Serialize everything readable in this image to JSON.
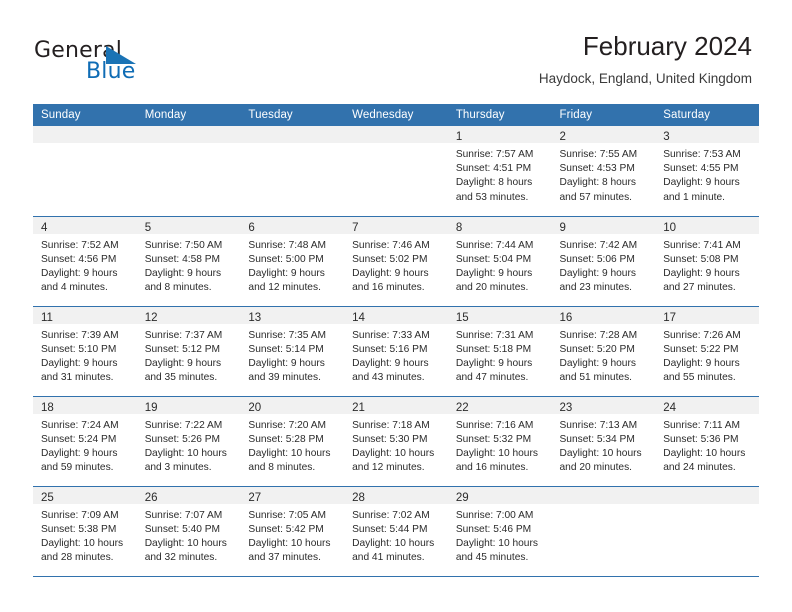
{
  "brand": {
    "name_part1": "General",
    "name_part2": "Blue",
    "flag_icon": "triangle-flag-icon"
  },
  "header": {
    "title": "February 2024",
    "location": "Haydock, England, United Kingdom"
  },
  "theme": {
    "header_blue": "#3272ad",
    "band_gray": "#f1f1f1",
    "brand_blue": "#0f6cb5",
    "text": "#2b2b2b"
  },
  "calendar": {
    "weekday_headers": [
      "Sunday",
      "Monday",
      "Tuesday",
      "Wednesday",
      "Thursday",
      "Friday",
      "Saturday"
    ],
    "weeks": [
      [
        {
          "day": "",
          "lines": []
        },
        {
          "day": "",
          "lines": []
        },
        {
          "day": "",
          "lines": []
        },
        {
          "day": "",
          "lines": []
        },
        {
          "day": "1",
          "lines": [
            "Sunrise: 7:57 AM",
            "Sunset: 4:51 PM",
            "Daylight: 8 hours",
            "and 53 minutes."
          ]
        },
        {
          "day": "2",
          "lines": [
            "Sunrise: 7:55 AM",
            "Sunset: 4:53 PM",
            "Daylight: 8 hours",
            "and 57 minutes."
          ]
        },
        {
          "day": "3",
          "lines": [
            "Sunrise: 7:53 AM",
            "Sunset: 4:55 PM",
            "Daylight: 9 hours",
            "and 1 minute."
          ]
        }
      ],
      [
        {
          "day": "4",
          "lines": [
            "Sunrise: 7:52 AM",
            "Sunset: 4:56 PM",
            "Daylight: 9 hours",
            "and 4 minutes."
          ]
        },
        {
          "day": "5",
          "lines": [
            "Sunrise: 7:50 AM",
            "Sunset: 4:58 PM",
            "Daylight: 9 hours",
            "and 8 minutes."
          ]
        },
        {
          "day": "6",
          "lines": [
            "Sunrise: 7:48 AM",
            "Sunset: 5:00 PM",
            "Daylight: 9 hours",
            "and 12 minutes."
          ]
        },
        {
          "day": "7",
          "lines": [
            "Sunrise: 7:46 AM",
            "Sunset: 5:02 PM",
            "Daylight: 9 hours",
            "and 16 minutes."
          ]
        },
        {
          "day": "8",
          "lines": [
            "Sunrise: 7:44 AM",
            "Sunset: 5:04 PM",
            "Daylight: 9 hours",
            "and 20 minutes."
          ]
        },
        {
          "day": "9",
          "lines": [
            "Sunrise: 7:42 AM",
            "Sunset: 5:06 PM",
            "Daylight: 9 hours",
            "and 23 minutes."
          ]
        },
        {
          "day": "10",
          "lines": [
            "Sunrise: 7:41 AM",
            "Sunset: 5:08 PM",
            "Daylight: 9 hours",
            "and 27 minutes."
          ]
        }
      ],
      [
        {
          "day": "11",
          "lines": [
            "Sunrise: 7:39 AM",
            "Sunset: 5:10 PM",
            "Daylight: 9 hours",
            "and 31 minutes."
          ]
        },
        {
          "day": "12",
          "lines": [
            "Sunrise: 7:37 AM",
            "Sunset: 5:12 PM",
            "Daylight: 9 hours",
            "and 35 minutes."
          ]
        },
        {
          "day": "13",
          "lines": [
            "Sunrise: 7:35 AM",
            "Sunset: 5:14 PM",
            "Daylight: 9 hours",
            "and 39 minutes."
          ]
        },
        {
          "day": "14",
          "lines": [
            "Sunrise: 7:33 AM",
            "Sunset: 5:16 PM",
            "Daylight: 9 hours",
            "and 43 minutes."
          ]
        },
        {
          "day": "15",
          "lines": [
            "Sunrise: 7:31 AM",
            "Sunset: 5:18 PM",
            "Daylight: 9 hours",
            "and 47 minutes."
          ]
        },
        {
          "day": "16",
          "lines": [
            "Sunrise: 7:28 AM",
            "Sunset: 5:20 PM",
            "Daylight: 9 hours",
            "and 51 minutes."
          ]
        },
        {
          "day": "17",
          "lines": [
            "Sunrise: 7:26 AM",
            "Sunset: 5:22 PM",
            "Daylight: 9 hours",
            "and 55 minutes."
          ]
        }
      ],
      [
        {
          "day": "18",
          "lines": [
            "Sunrise: 7:24 AM",
            "Sunset: 5:24 PM",
            "Daylight: 9 hours",
            "and 59 minutes."
          ]
        },
        {
          "day": "19",
          "lines": [
            "Sunrise: 7:22 AM",
            "Sunset: 5:26 PM",
            "Daylight: 10 hours",
            "and 3 minutes."
          ]
        },
        {
          "day": "20",
          "lines": [
            "Sunrise: 7:20 AM",
            "Sunset: 5:28 PM",
            "Daylight: 10 hours",
            "and 8 minutes."
          ]
        },
        {
          "day": "21",
          "lines": [
            "Sunrise: 7:18 AM",
            "Sunset: 5:30 PM",
            "Daylight: 10 hours",
            "and 12 minutes."
          ]
        },
        {
          "day": "22",
          "lines": [
            "Sunrise: 7:16 AM",
            "Sunset: 5:32 PM",
            "Daylight: 10 hours",
            "and 16 minutes."
          ]
        },
        {
          "day": "23",
          "lines": [
            "Sunrise: 7:13 AM",
            "Sunset: 5:34 PM",
            "Daylight: 10 hours",
            "and 20 minutes."
          ]
        },
        {
          "day": "24",
          "lines": [
            "Sunrise: 7:11 AM",
            "Sunset: 5:36 PM",
            "Daylight: 10 hours",
            "and 24 minutes."
          ]
        }
      ],
      [
        {
          "day": "25",
          "lines": [
            "Sunrise: 7:09 AM",
            "Sunset: 5:38 PM",
            "Daylight: 10 hours",
            "and 28 minutes."
          ]
        },
        {
          "day": "26",
          "lines": [
            "Sunrise: 7:07 AM",
            "Sunset: 5:40 PM",
            "Daylight: 10 hours",
            "and 32 minutes."
          ]
        },
        {
          "day": "27",
          "lines": [
            "Sunrise: 7:05 AM",
            "Sunset: 5:42 PM",
            "Daylight: 10 hours",
            "and 37 minutes."
          ]
        },
        {
          "day": "28",
          "lines": [
            "Sunrise: 7:02 AM",
            "Sunset: 5:44 PM",
            "Daylight: 10 hours",
            "and 41 minutes."
          ]
        },
        {
          "day": "29",
          "lines": [
            "Sunrise: 7:00 AM",
            "Sunset: 5:46 PM",
            "Daylight: 10 hours",
            "and 45 minutes."
          ]
        },
        {
          "day": "",
          "lines": []
        },
        {
          "day": "",
          "lines": []
        }
      ]
    ]
  }
}
